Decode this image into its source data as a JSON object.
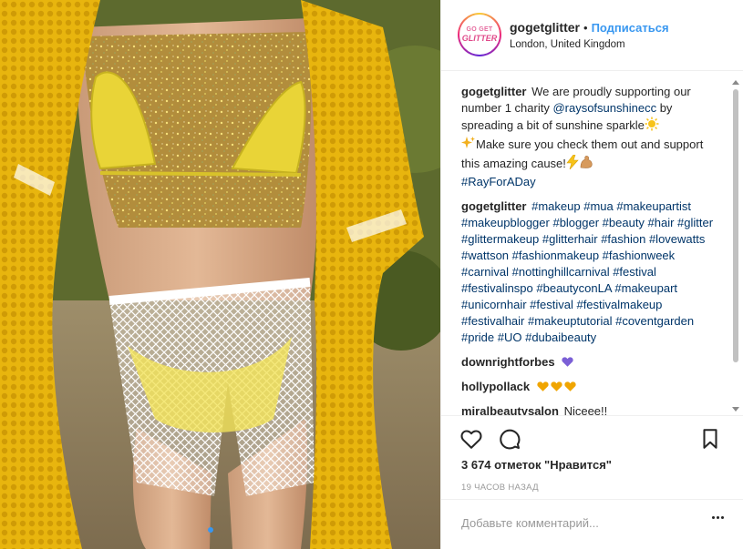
{
  "post": {
    "username": "gogetglitter",
    "separator": "•",
    "follow_label": "Подписаться",
    "location": "London, United Kingdom",
    "avatar": {
      "line1": "GO GET",
      "line2": "GLITTER"
    }
  },
  "caption": {
    "user": "gogetglitter",
    "text_1": " We are proudly supporting our number 1 charity ",
    "mention": "@raysofsunshinecc",
    "text_2": " by spreading a bit of sunshine sparkle",
    "emoji_1": "☀️",
    "text_3": "Make sure you check them out and support this amazing cause!",
    "emoji_2": "⚡💪",
    "hashtag": "#RayForADay",
    "sparkle_emoji": "✨"
  },
  "tags_comment": {
    "user": "gogetglitter",
    "tags": "#makeup #mua #makeupartist #makeupblogger #blogger #beauty #hair #glitter #glittermakeup #glitterhair #fashion #lovewatts #wattson #fashionmakeup #fashionweek #carnival #nottinghillcarnival #festival #festivalinspo #beautyconLA #makeupart #unicornhair #festival #festivalmakeup #festivalhair #makeuptutorial #coventgarden #pride #UO #dubaibeauty"
  },
  "comments": [
    {
      "user": "downrightforbes",
      "text": "",
      "hearts": [
        "#7b5fd6"
      ]
    },
    {
      "user": "hollypollack",
      "text": "",
      "hearts": [
        "#f0a500",
        "#f0a500",
        "#f0a500"
      ]
    },
    {
      "user": "miralbeautysalon",
      "text": "Niceee!!",
      "hearts": []
    }
  ],
  "actions": {
    "icons": [
      "heart-icon",
      "comment-icon",
      "bookmark-icon"
    ],
    "likes": "3 674 отметок \"Нравится\"",
    "time": "19 ЧАСОВ НАЗАД"
  },
  "add_comment": {
    "placeholder": "Добавьте комментарий..."
  },
  "colors": {
    "link": "#003569",
    "follow": "#3897f0",
    "text": "#262626",
    "muted": "#999999"
  }
}
